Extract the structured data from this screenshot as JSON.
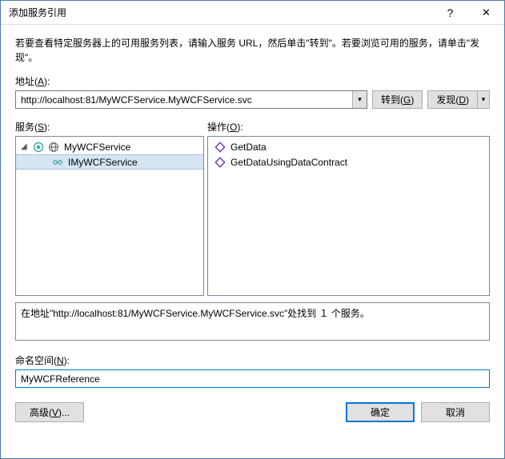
{
  "title": "添加服务引用",
  "intro": "若要查看特定服务器上的可用服务列表，请输入服务 URL，然后单击\"转到\"。若要浏览可用的服务，请单击\"发现\"。",
  "address": {
    "label": "地址(A):",
    "value": "http://localhost:81/MyWCFService.MyWCFService.svc"
  },
  "buttons": {
    "go": "转到(G)",
    "discover": "发现(D)",
    "advanced": "高级(V)...",
    "ok": "确定",
    "cancel": "取消"
  },
  "services": {
    "label": "服务(S):",
    "root": "MyWCFService",
    "child": "IMyWCFService"
  },
  "operations": {
    "label": "操作(O):",
    "items": [
      "GetData",
      "GetDataUsingDataContract"
    ]
  },
  "status": "在地址\"http://localhost:81/MyWCFService.MyWCFService.svc\"处找到 １ 个服务。",
  "namespace": {
    "label": "命名空间(N):",
    "value": "MyWCFReference"
  },
  "colors": {
    "accent": "#0078d7",
    "selection": "#d6e5f3",
    "border": "#828790",
    "iconPurple": "#7b3fb5",
    "iconTeal": "#3ca8a8"
  }
}
